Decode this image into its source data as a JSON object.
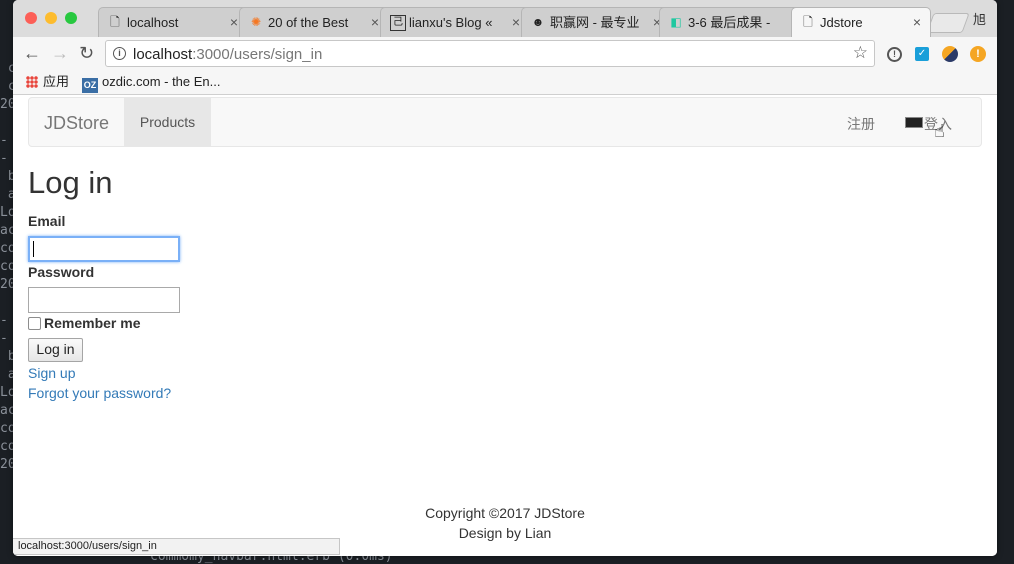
{
  "browser": {
    "tabs": [
      {
        "title": "localhost",
        "icon": "page-icon"
      },
      {
        "title": "20 of the Best",
        "icon": "hubspot-icon"
      },
      {
        "title": "lianxu's Blog «",
        "icon": "blog-icon"
      },
      {
        "title": "职赢网 - 最专业",
        "icon": "user-icon"
      },
      {
        "title": "3-6 最后成果 -",
        "icon": "green-logo-icon"
      },
      {
        "title": "Jdstore",
        "icon": "page-icon"
      }
    ],
    "profile_label": "旭",
    "url_host": "localhost",
    "url_rest": ":3000/users/sign_in",
    "bookmarks": [
      {
        "label": "应用",
        "icon": "apps-icon"
      },
      {
        "label": "ozdic.com - the En...",
        "icon": "ozdic-icon"
      }
    ],
    "status_url": "localhost:3000/users/sign_in"
  },
  "navbar": {
    "brand": "JDStore",
    "products": "Products",
    "signup": "注册",
    "login": "登入"
  },
  "form": {
    "title": "Log in",
    "email_label": "Email",
    "email_value": "",
    "password_label": "Password",
    "password_value": "",
    "remember_label": "Remember me",
    "submit_label": "Log in"
  },
  "links": {
    "signup": "Sign up",
    "forgot": "Forgot your password?"
  },
  "footer": {
    "copyright": "Copyright ©2017 JDStore",
    "design": "Design by Lian"
  },
  "colors": {
    "link": "#337ab7",
    "focus_ring": "#7ab0f7",
    "navbar_bg": "#f8f8f8",
    "active_nav_bg": "#e7e7e7"
  }
}
